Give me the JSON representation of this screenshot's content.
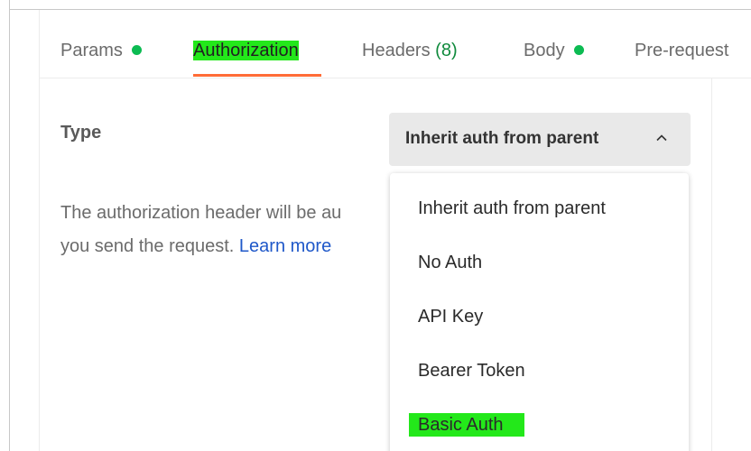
{
  "tabs": [
    {
      "label": "Params",
      "dot": true
    },
    {
      "label": "Authorization",
      "active": true
    },
    {
      "label": "Headers",
      "count": "(8)"
    },
    {
      "label": "Body",
      "dot": true
    },
    {
      "label": "Pre-request"
    }
  ],
  "auth": {
    "type_label": "Type",
    "selected": "Inherit auth from parent",
    "description_line1": "The authorization header will be au",
    "description_line2": "you send the request.",
    "learn_more": "Learn more"
  },
  "dropdown": {
    "options": [
      "Inherit auth from parent",
      "No Auth",
      "API Key",
      "Bearer Token",
      "Basic Auth"
    ]
  },
  "colors": {
    "accent_underline": "#ff6c37",
    "status_dot": "#0cbb52",
    "highlight": "#23e81a",
    "link": "#1f58c9"
  }
}
